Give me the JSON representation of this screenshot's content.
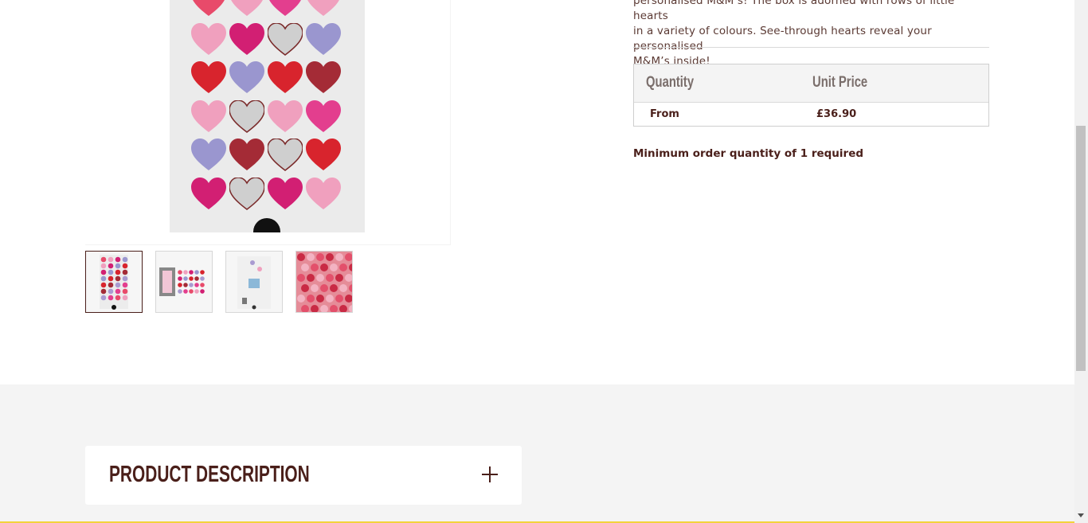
{
  "product": {
    "description_lines": [
      "personalised M&M’s! The box is adorned with rows of little hearts",
      "in a variety of colours. See-through hearts reveal your personalised",
      "M&M’s inside!"
    ],
    "main_image_alt": "Hearts gift box with personalised M&M's",
    "heart_colors": [
      "#e84a6a",
      "#f0a0be",
      "#d21f73",
      "#9a96cf",
      "#d8242d",
      "#a42b36",
      "#a99bd1",
      "#e33e8e"
    ]
  },
  "thumbnails": [
    {
      "label": "Hearts box front",
      "active": true
    },
    {
      "label": "Hearts box open",
      "active": false
    },
    {
      "label": "Hearts box side",
      "active": false
    },
    {
      "label": "Pink personalised M&M's",
      "active": false
    }
  ],
  "price_table": {
    "headers": [
      "Quantity",
      "Unit Price"
    ],
    "rows": [
      {
        "quantity": "From",
        "price": "£36.90"
      }
    ]
  },
  "min_order": "Minimum order quantity of 1 required",
  "accordion": {
    "title": "PRODUCT DESCRIPTION",
    "icon": "plus-icon"
  },
  "colors": {
    "brand_text": "#4a1f1a",
    "section_bg": "#f4f4f4",
    "footer_accent": "#f3d33c"
  }
}
